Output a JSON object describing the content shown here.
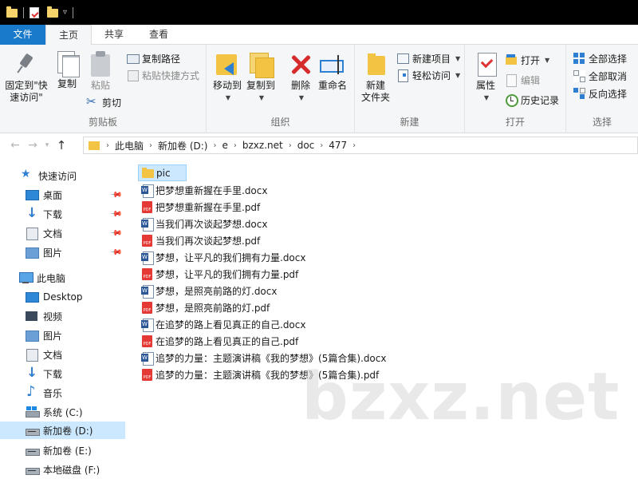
{
  "titlebar": {
    "separator": "|"
  },
  "tabs": [
    "文件",
    "主页",
    "共享",
    "查看"
  ],
  "ribbon": {
    "clipboard": {
      "pin_label": "固定到\"快\n速访问\"",
      "copy_label": "复制",
      "paste_label": "粘贴",
      "copy_path": "复制路径",
      "paste_shortcut": "粘贴快捷方式",
      "cut": "剪切",
      "group_label": "剪贴板"
    },
    "organize": {
      "move_to": "移动到",
      "copy_to": "复制到",
      "delete": "删除",
      "rename": "重命名",
      "group_label": "组织"
    },
    "new": {
      "new_folder": "新建\n文件夹",
      "new_item": "新建项目",
      "easy_access": "轻松访问",
      "group_label": "新建"
    },
    "open": {
      "properties": "属性",
      "open": "打开",
      "edit": "编辑",
      "history": "历史记录",
      "group_label": "打开"
    },
    "select": {
      "select_all": "全部选择",
      "select_none": "全部取消",
      "invert": "反向选择",
      "group_label": "选择"
    }
  },
  "address": {
    "segments": [
      "此电脑",
      "新加卷 (D:)",
      "e",
      "bzxz.net",
      "doc",
      "477"
    ]
  },
  "navpane": {
    "quick_access": "快速访问",
    "quick_items": [
      "桌面",
      "下载",
      "文档",
      "图片"
    ],
    "this_pc": "此电脑",
    "pc_items": [
      "Desktop",
      "视频",
      "图片",
      "文档",
      "下载",
      "音乐"
    ],
    "drives": [
      "系统 (C:)",
      "新加卷 (D:)",
      "新加卷 (E:)",
      "本地磁盘 (F:)"
    ]
  },
  "files": [
    {
      "name": "pic",
      "type": "folder"
    },
    {
      "name": "把梦想重新握在手里.docx",
      "type": "docx"
    },
    {
      "name": "把梦想重新握在手里.pdf",
      "type": "pdf"
    },
    {
      "name": "当我们再次谈起梦想.docx",
      "type": "docx"
    },
    {
      "name": "当我们再次谈起梦想.pdf",
      "type": "pdf"
    },
    {
      "name": "梦想，让平凡的我们拥有力量.docx",
      "type": "docx"
    },
    {
      "name": "梦想，让平凡的我们拥有力量.pdf",
      "type": "pdf"
    },
    {
      "name": "梦想，是照亮前路的灯.docx",
      "type": "docx"
    },
    {
      "name": "梦想，是照亮前路的灯.pdf",
      "type": "pdf"
    },
    {
      "name": "在追梦的路上看见真正的自己.docx",
      "type": "docx"
    },
    {
      "name": "在追梦的路上看见真正的自己.pdf",
      "type": "pdf"
    },
    {
      "name": "追梦的力量：主题演讲稿《我的梦想》(5篇合集).docx",
      "type": "docx"
    },
    {
      "name": "追梦的力量：主题演讲稿《我的梦想》(5篇合集).pdf",
      "type": "pdf"
    }
  ],
  "watermark": "bzxz.net",
  "colors": {
    "accent": "#1979ca",
    "selection": "#cce8ff",
    "ribbon_bg": "#f5f6f7"
  }
}
